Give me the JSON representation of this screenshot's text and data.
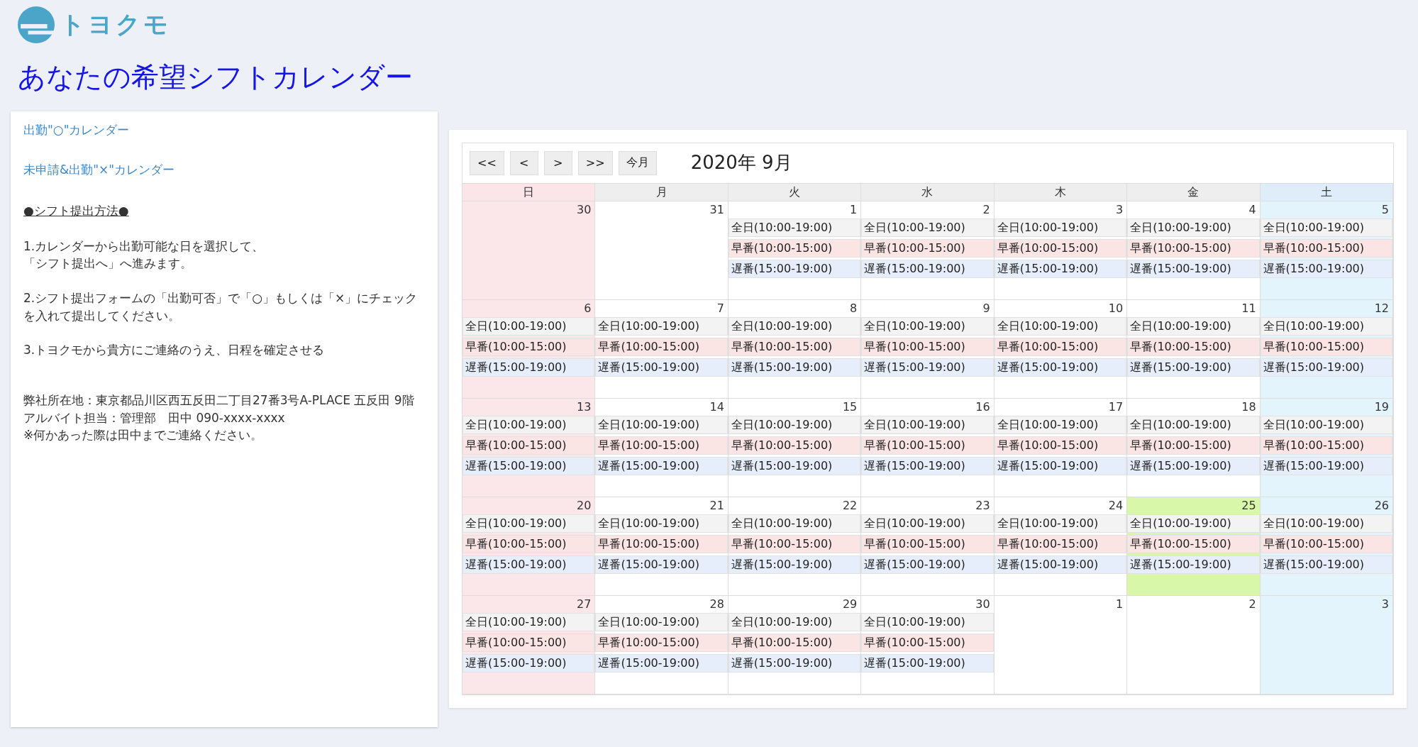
{
  "logo": {
    "text": "トヨクモ"
  },
  "title": "あなたの希望シフトカレンダー",
  "sidebar": {
    "links": [
      "出勤\"○\"カレンダー",
      "未申請&出勤\"×\"カレンダー"
    ],
    "heading": "●シフト提出方法●",
    "steps": [
      [
        "1.カレンダーから出勤可能な日を選択して、",
        "「シフト提出へ」へ進みます。"
      ],
      [
        "2.シフト提出フォームの「出勤可否」で「○」もしくは「×」にチェックを入れて提出してください。"
      ],
      [
        "3.トヨクモから貴方にご連絡のうえ、日程を確定させる"
      ]
    ],
    "contact": [
      "弊社所在地：東京都品川区西五反田二丁目27番3号A-PLACE 五反田 9階",
      "アルバイト担当：管理部　田中 090-xxxx-xxxx",
      "※何かあった際は田中までご連絡ください。"
    ]
  },
  "calendar": {
    "buttons": [
      "<<",
      "<",
      ">",
      ">>",
      "今月"
    ],
    "month": "2020年 9月",
    "headers": [
      {
        "label": "日",
        "kind": "sun"
      },
      {
        "label": "月",
        "kind": "weekday"
      },
      {
        "label": "火",
        "kind": "weekday"
      },
      {
        "label": "水",
        "kind": "weekday"
      },
      {
        "label": "木",
        "kind": "weekday"
      },
      {
        "label": "金",
        "kind": "weekday"
      },
      {
        "label": "土",
        "kind": "sat"
      }
    ],
    "weeks": [
      [
        {
          "day": "30",
          "today": false
        },
        {
          "day": "31",
          "today": false
        },
        {
          "day": "1",
          "today": false,
          "events": [
            {
              "kind": "all",
              "text": "全日(10:00-19:00)"
            },
            {
              "kind": "early",
              "text": "早番(10:00-15:00)"
            },
            {
              "kind": "late",
              "text": "遅番(15:00-19:00)"
            }
          ]
        },
        {
          "day": "2",
          "today": false,
          "events": [
            {
              "kind": "all",
              "text": "全日(10:00-19:00)"
            },
            {
              "kind": "early",
              "text": "早番(10:00-15:00)"
            },
            {
              "kind": "late",
              "text": "遅番(15:00-19:00)"
            }
          ]
        },
        {
          "day": "3",
          "today": false,
          "events": [
            {
              "kind": "all",
              "text": "全日(10:00-19:00)"
            },
            {
              "kind": "early",
              "text": "早番(10:00-15:00)"
            },
            {
              "kind": "late",
              "text": "遅番(15:00-19:00)"
            }
          ]
        },
        {
          "day": "4",
          "today": false,
          "events": [
            {
              "kind": "all",
              "text": "全日(10:00-19:00)"
            },
            {
              "kind": "early",
              "text": "早番(10:00-15:00)"
            },
            {
              "kind": "late",
              "text": "遅番(15:00-19:00)"
            }
          ]
        },
        {
          "day": "5",
          "today": false,
          "events": [
            {
              "kind": "all",
              "text": "全日(10:00-19:00)"
            },
            {
              "kind": "early",
              "text": "早番(10:00-15:00)"
            },
            {
              "kind": "late",
              "text": "遅番(15:00-19:00)"
            }
          ]
        }
      ],
      [
        {
          "day": "6",
          "today": false,
          "events": [
            {
              "kind": "all",
              "text": "全日(10:00-19:00)"
            },
            {
              "kind": "early",
              "text": "早番(10:00-15:00)"
            },
            {
              "kind": "late",
              "text": "遅番(15:00-19:00)"
            }
          ]
        },
        {
          "day": "7",
          "today": false,
          "events": [
            {
              "kind": "all",
              "text": "全日(10:00-19:00)"
            },
            {
              "kind": "early",
              "text": "早番(10:00-15:00)"
            },
            {
              "kind": "late",
              "text": "遅番(15:00-19:00)"
            }
          ]
        },
        {
          "day": "8",
          "today": false,
          "events": [
            {
              "kind": "all",
              "text": "全日(10:00-19:00)"
            },
            {
              "kind": "early",
              "text": "早番(10:00-15:00)"
            },
            {
              "kind": "late",
              "text": "遅番(15:00-19:00)"
            }
          ]
        },
        {
          "day": "9",
          "today": false,
          "events": [
            {
              "kind": "all",
              "text": "全日(10:00-19:00)"
            },
            {
              "kind": "early",
              "text": "早番(10:00-15:00)"
            },
            {
              "kind": "late",
              "text": "遅番(15:00-19:00)"
            }
          ]
        },
        {
          "day": "10",
          "today": false,
          "events": [
            {
              "kind": "all",
              "text": "全日(10:00-19:00)"
            },
            {
              "kind": "early",
              "text": "早番(10:00-15:00)"
            },
            {
              "kind": "late",
              "text": "遅番(15:00-19:00)"
            }
          ]
        },
        {
          "day": "11",
          "today": false,
          "events": [
            {
              "kind": "all",
              "text": "全日(10:00-19:00)"
            },
            {
              "kind": "early",
              "text": "早番(10:00-15:00)"
            },
            {
              "kind": "late",
              "text": "遅番(15:00-19:00)"
            }
          ]
        },
        {
          "day": "12",
          "today": false,
          "events": [
            {
              "kind": "all",
              "text": "全日(10:00-19:00)"
            },
            {
              "kind": "early",
              "text": "早番(10:00-15:00)"
            },
            {
              "kind": "late",
              "text": "遅番(15:00-19:00)"
            }
          ]
        }
      ],
      [
        {
          "day": "13",
          "today": false,
          "events": [
            {
              "kind": "all",
              "text": "全日(10:00-19:00)"
            },
            {
              "kind": "early",
              "text": "早番(10:00-15:00)"
            },
            {
              "kind": "late",
              "text": "遅番(15:00-19:00)"
            }
          ]
        },
        {
          "day": "14",
          "today": false,
          "events": [
            {
              "kind": "all",
              "text": "全日(10:00-19:00)"
            },
            {
              "kind": "early",
              "text": "早番(10:00-15:00)"
            },
            {
              "kind": "late",
              "text": "遅番(15:00-19:00)"
            }
          ]
        },
        {
          "day": "15",
          "today": false,
          "events": [
            {
              "kind": "all",
              "text": "全日(10:00-19:00)"
            },
            {
              "kind": "early",
              "text": "早番(10:00-15:00)"
            },
            {
              "kind": "late",
              "text": "遅番(15:00-19:00)"
            }
          ]
        },
        {
          "day": "16",
          "today": false,
          "events": [
            {
              "kind": "all",
              "text": "全日(10:00-19:00)"
            },
            {
              "kind": "early",
              "text": "早番(10:00-15:00)"
            },
            {
              "kind": "late",
              "text": "遅番(15:00-19:00)"
            }
          ]
        },
        {
          "day": "17",
          "today": false,
          "events": [
            {
              "kind": "all",
              "text": "全日(10:00-19:00)"
            },
            {
              "kind": "early",
              "text": "早番(10:00-15:00)"
            },
            {
              "kind": "late",
              "text": "遅番(15:00-19:00)"
            }
          ]
        },
        {
          "day": "18",
          "today": false,
          "events": [
            {
              "kind": "all",
              "text": "全日(10:00-19:00)"
            },
            {
              "kind": "early",
              "text": "早番(10:00-15:00)"
            },
            {
              "kind": "late",
              "text": "遅番(15:00-19:00)"
            }
          ]
        },
        {
          "day": "19",
          "today": false,
          "events": [
            {
              "kind": "all",
              "text": "全日(10:00-19:00)"
            },
            {
              "kind": "early",
              "text": "早番(10:00-15:00)"
            },
            {
              "kind": "late",
              "text": "遅番(15:00-19:00)"
            }
          ]
        }
      ],
      [
        {
          "day": "20",
          "today": false,
          "events": [
            {
              "kind": "all",
              "text": "全日(10:00-19:00)"
            },
            {
              "kind": "early",
              "text": "早番(10:00-15:00)"
            },
            {
              "kind": "late",
              "text": "遅番(15:00-19:00)"
            }
          ]
        },
        {
          "day": "21",
          "today": false,
          "events": [
            {
              "kind": "all",
              "text": "全日(10:00-19:00)"
            },
            {
              "kind": "early",
              "text": "早番(10:00-15:00)"
            },
            {
              "kind": "late",
              "text": "遅番(15:00-19:00)"
            }
          ]
        },
        {
          "day": "22",
          "today": false,
          "events": [
            {
              "kind": "all",
              "text": "全日(10:00-19:00)"
            },
            {
              "kind": "early",
              "text": "早番(10:00-15:00)"
            },
            {
              "kind": "late",
              "text": "遅番(15:00-19:00)"
            }
          ]
        },
        {
          "day": "23",
          "today": false,
          "events": [
            {
              "kind": "all",
              "text": "全日(10:00-19:00)"
            },
            {
              "kind": "early",
              "text": "早番(10:00-15:00)"
            },
            {
              "kind": "late",
              "text": "遅番(15:00-19:00)"
            }
          ]
        },
        {
          "day": "24",
          "today": false,
          "events": [
            {
              "kind": "all",
              "text": "全日(10:00-19:00)"
            },
            {
              "kind": "early",
              "text": "早番(10:00-15:00)"
            },
            {
              "kind": "late",
              "text": "遅番(15:00-19:00)"
            }
          ]
        },
        {
          "day": "25",
          "today": true,
          "events": [
            {
              "kind": "all",
              "text": "全日(10:00-19:00)"
            },
            {
              "kind": "early",
              "text": "早番(10:00-15:00)"
            },
            {
              "kind": "late",
              "text": "遅番(15:00-19:00)"
            }
          ]
        },
        {
          "day": "26",
          "today": false,
          "events": [
            {
              "kind": "all",
              "text": "全日(10:00-19:00)"
            },
            {
              "kind": "early",
              "text": "早番(10:00-15:00)"
            },
            {
              "kind": "late",
              "text": "遅番(15:00-19:00)"
            }
          ]
        }
      ],
      [
        {
          "day": "27",
          "today": false,
          "events": [
            {
              "kind": "all",
              "text": "全日(10:00-19:00)"
            },
            {
              "kind": "early",
              "text": "早番(10:00-15:00)"
            },
            {
              "kind": "late",
              "text": "遅番(15:00-19:00)"
            }
          ]
        },
        {
          "day": "28",
          "today": false,
          "events": [
            {
              "kind": "all",
              "text": "全日(10:00-19:00)"
            },
            {
              "kind": "early",
              "text": "早番(10:00-15:00)"
            },
            {
              "kind": "late",
              "text": "遅番(15:00-19:00)"
            }
          ]
        },
        {
          "day": "29",
          "today": false,
          "events": [
            {
              "kind": "all",
              "text": "全日(10:00-19:00)"
            },
            {
              "kind": "early",
              "text": "早番(10:00-15:00)"
            },
            {
              "kind": "late",
              "text": "遅番(15:00-19:00)"
            }
          ]
        },
        {
          "day": "30",
          "today": false,
          "events": [
            {
              "kind": "all",
              "text": "全日(10:00-19:00)"
            },
            {
              "kind": "early",
              "text": "早番(10:00-15:00)"
            },
            {
              "kind": "late",
              "text": "遅番(15:00-19:00)"
            }
          ]
        },
        {
          "day": "1",
          "today": false
        },
        {
          "day": "2",
          "today": false
        },
        {
          "day": "3",
          "today": false
        }
      ]
    ]
  }
}
